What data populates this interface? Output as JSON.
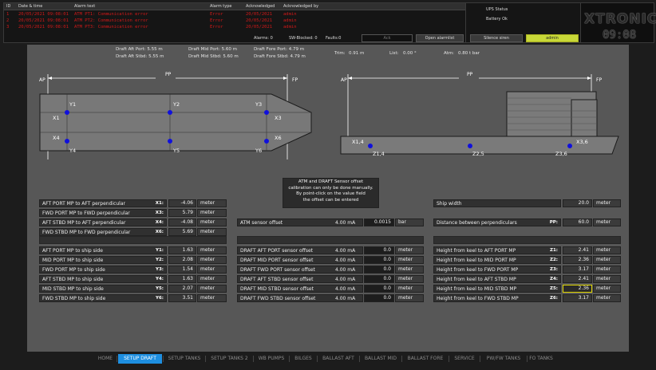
{
  "alarms": {
    "columns": {
      "id": "ID",
      "datetime": "Date & time",
      "text": "Alarm text",
      "type": "Alarm type",
      "acknowledged": "Acknowledged",
      "acknowledged_by": "Acknowledged by"
    },
    "rows": [
      {
        "id": "1",
        "datetime": "20/05/2021 09:08:01",
        "text": "ATM PT1: Communication error",
        "type": "Error",
        "acknowledged": "20/05/2021",
        "acknowledged_by": "admin"
      },
      {
        "id": "2",
        "datetime": "20/05/2021 09:08:01",
        "text": "ATM PT2: Communication error",
        "type": "Error",
        "acknowledged": "20/05/2021",
        "acknowledged_by": "admin"
      },
      {
        "id": "3",
        "datetime": "20/05/2021 09:08:01",
        "text": "ATM PT3: Communication error",
        "type": "Error",
        "acknowledged": "20/05/2021",
        "acknowledged_by": "admin"
      }
    ],
    "counters": {
      "alarms": "Alarms: 0",
      "sw_blocked": "SW-Blocked: 0",
      "faults": "Faults:0"
    },
    "ack_field": "Ack",
    "buttons": {
      "open_alarm_list": "Open alarmlist",
      "silence_siren": "Silence siren",
      "user": "admin"
    }
  },
  "status": {
    "ups_label": "UPS Status",
    "battery": "Battery Ok"
  },
  "brand": {
    "logo": "XTRONICA",
    "clock": "09:08"
  },
  "draft": {
    "aft_port": "Draft Aft Port: 5.55 m",
    "aft_stbd": "Draft Aft Stbd: 5.55 m",
    "mid_port": "Draft Mid Port: 5.60 m",
    "mid_stbd": "Draft Mid Stbd: 5.60 m",
    "fore_port": "Draft Fore Port: 4.79 m",
    "fore_stbd": "Draft Fore Stbd: 4.79 m",
    "trim": "Trim:",
    "trim_value": "0.91 m",
    "list": "List:",
    "list_value": "0.00 °",
    "atm": "Atm:",
    "atm_value": "0.80 t bar"
  },
  "diagram": {
    "ap": "AP",
    "pp": "PP",
    "fp": "FP",
    "top_labels": {
      "y1": "Y1",
      "y2": "Y2",
      "y3": "Y3",
      "x1": "X1",
      "x3": "X3",
      "x4": "X4",
      "x6": "X6",
      "y4": "Y4",
      "y5": "Y5",
      "y6": "Y6"
    },
    "side_labels": {
      "x14": "X1,4",
      "z14": "Z1,4",
      "z25": "Z2,5",
      "z36": "Z3,6",
      "x36": "X3,6"
    }
  },
  "note": {
    "line1": "ATM and DRAFT Sensor offset",
    "line2": "calibration can only be done manually.",
    "line3": "By point-click on the value field",
    "line4": "the offset can be entered"
  },
  "perpendiculars": [
    {
      "label": "AFT PORT MP to AFT perpendicular",
      "sym": "X1:",
      "value": "-4.06",
      "unit": "meter"
    },
    {
      "label": "FWD PORT MP to FWD perpendicular",
      "sym": "X3:",
      "value": "5.79",
      "unit": "meter"
    },
    {
      "label": "AFT STBD MP to AFT perpendicular",
      "sym": "X4:",
      "value": "-4.08",
      "unit": "meter"
    },
    {
      "label": "FWD STBD MP to FWD perpendicular",
      "sym": "X6:",
      "value": "5.69",
      "unit": "meter"
    }
  ],
  "shipside": [
    {
      "label": "AFT PORT MP to ship side",
      "sym": "Y1:",
      "value": "1.63",
      "unit": "meter"
    },
    {
      "label": "MID PORT MP to ship side",
      "sym": "Y2:",
      "value": "2.08",
      "unit": "meter"
    },
    {
      "label": "FWD PORT MP to ship side",
      "sym": "Y3:",
      "value": "1.54",
      "unit": "meter"
    },
    {
      "label": "AFT STBD MP to ship side",
      "sym": "Y4:",
      "value": "1.63",
      "unit": "meter"
    },
    {
      "label": "MID STBD MP to ship side",
      "sym": "Y5:",
      "value": "2.07",
      "unit": "meter"
    },
    {
      "label": "FWD STBD MP to ship side",
      "sym": "Y6:",
      "value": "3.51",
      "unit": "meter"
    }
  ],
  "atm_sensor": {
    "label": "ATM sensor offset",
    "ma": "4.00 mA",
    "value": "0.0015",
    "unit": "bar"
  },
  "draft_offsets": [
    {
      "label": "DRAFT AFT PORT sensor offset",
      "ma": "4.00 mA",
      "value": "0.0",
      "unit": "meter"
    },
    {
      "label": "DRAFT MID PORT sensor offset",
      "ma": "4.00 mA",
      "value": "0.0",
      "unit": "meter"
    },
    {
      "label": "DRAFT FWD PORT sensor offset",
      "ma": "4.00 mA",
      "value": "0.0",
      "unit": "meter"
    },
    {
      "label": "DRAFT AFT STBD sensor offset",
      "ma": "4.00 mA",
      "value": "0.0",
      "unit": "meter"
    },
    {
      "label": "DRAFT MID STBD sensor offset",
      "ma": "4.00 mA",
      "value": "0.0",
      "unit": "meter"
    },
    {
      "label": "DRAFT FWD STBD sensor offset",
      "ma": "4.00 mA",
      "value": "0.0",
      "unit": "meter"
    }
  ],
  "ship_width": {
    "label": "Ship width",
    "value": "20.0",
    "unit": "meter"
  },
  "dist_perp": {
    "label": "Distance between perpendiculars",
    "sym": "PP:",
    "value": "60.0",
    "unit": "meter"
  },
  "keel": [
    {
      "label": "Height from keel to AFT PORT MP",
      "sym": "Z1:",
      "value": "2.41",
      "unit": "meter"
    },
    {
      "label": "Height from keel to MID PORT MP",
      "sym": "Z2:",
      "value": "2.36",
      "unit": "meter"
    },
    {
      "label": "Height from keel to FWD PORT MP",
      "sym": "Z3:",
      "value": "3.17",
      "unit": "meter"
    },
    {
      "label": "Height from keel to AFT STBD MP",
      "sym": "Z4:",
      "value": "2.41",
      "unit": "meter"
    },
    {
      "label": "Height from keel to MID STBD MP",
      "sym": "Z5:",
      "value": "2.36",
      "unit": "meter"
    },
    {
      "label": "Height from keel to FWD STBD MP",
      "sym": "Z6:",
      "value": "3.17",
      "unit": "meter"
    }
  ],
  "tabs": [
    "HOME",
    "SETUP DRAFT",
    "SETUP TANKS",
    "SETUP TANKS 2",
    "WB PUMPS",
    "BILGES",
    "BALLAST AFT",
    "BALLAST MID",
    "BALLAST FORE",
    "SERVICE",
    "PW/FW TANKS",
    "FO TANKS"
  ],
  "active_tab": "SETUP DRAFT",
  "colors": {
    "accent": "#1e8fe0",
    "alarm_text": "#d01818",
    "measure_point": "#1010dd",
    "admin_button": "#c8d838",
    "highlight_border": "#e0d600"
  }
}
